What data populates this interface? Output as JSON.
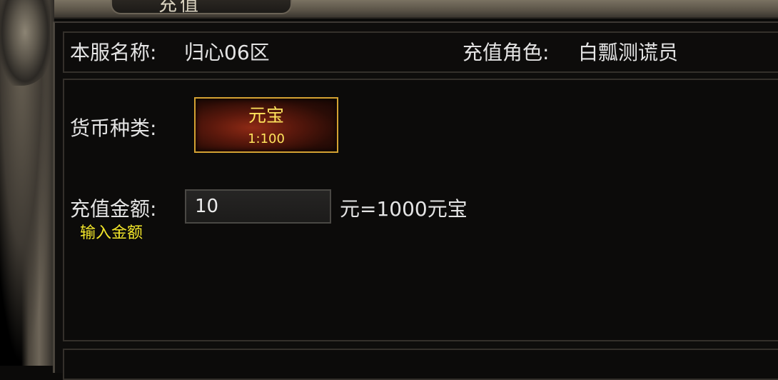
{
  "window": {
    "title": "充值"
  },
  "header": {
    "server_label": "本服名称:",
    "server_value": "归心06区",
    "role_label": "充值角色:",
    "role_value": "白瓢测谎员"
  },
  "currency": {
    "label": "货币种类:",
    "name": "元宝",
    "ratio": "1:100",
    "border_color": "#d4a232",
    "text_color": "#ffe35c"
  },
  "amount": {
    "label": "充值金额:",
    "value": "10",
    "hint": "输入金额",
    "result": "元=1000元宝"
  }
}
